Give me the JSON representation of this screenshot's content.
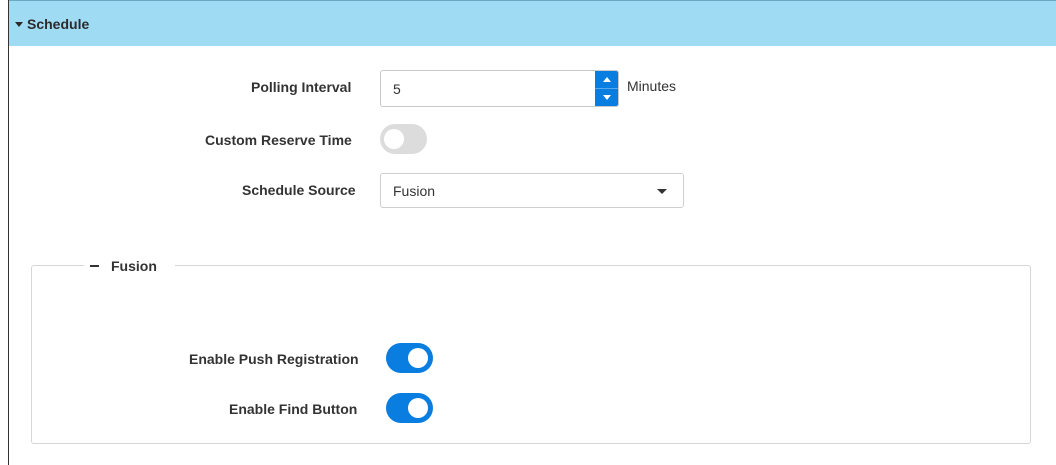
{
  "section": {
    "title": "Schedule",
    "expanded": true
  },
  "polling_interval": {
    "label": "Polling Interval",
    "value": "5",
    "units": "Minutes"
  },
  "custom_reserve_time": {
    "label": "Custom Reserve Time",
    "enabled": false
  },
  "schedule_source": {
    "label": "Schedule Source",
    "value": "Fusion"
  },
  "fusion": {
    "title": "Fusion",
    "expanded": true,
    "enable_push_registration": {
      "label": "Enable Push Registration",
      "enabled": true
    },
    "enable_find_button": {
      "label": "Enable Find Button",
      "enabled": true
    }
  },
  "colors": {
    "header_bg": "#9fdcf4",
    "accent": "#0a7ee0",
    "toggle_off": "#dcdcdc"
  },
  "icons": {
    "section_caret": "caret-down-icon",
    "spinner_up": "arrow-up-icon",
    "spinner_down": "arrow-down-icon",
    "select_arrow": "dropdown-arrow-icon",
    "collapse": "minus-icon"
  }
}
